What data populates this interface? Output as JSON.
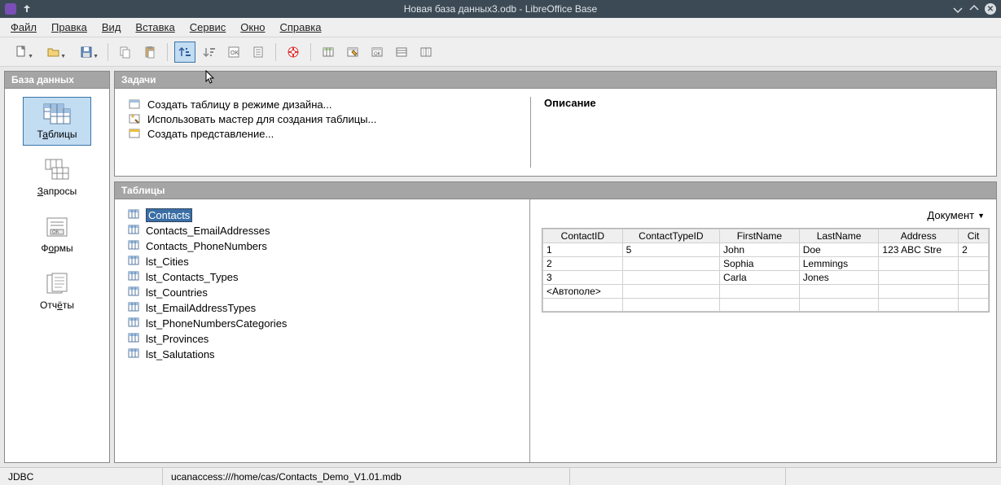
{
  "window": {
    "title": "Новая база данных3.odb - LibreOffice Base"
  },
  "menu": {
    "file": "Файл",
    "edit": "Правка",
    "view": "Вид",
    "insert": "Вставка",
    "service": "Сервис",
    "window": "Окно",
    "help": "Справка"
  },
  "sidebar": {
    "header": "База данных",
    "items": [
      {
        "label_pre": "Т",
        "label_ul": "а",
        "label_post": "блицы"
      },
      {
        "label_pre": "",
        "label_ul": "З",
        "label_post": "апросы"
      },
      {
        "label_pre": "Ф",
        "label_ul": "о",
        "label_post": "рмы"
      },
      {
        "label_pre": "Отч",
        "label_ul": "ё",
        "label_post": "ты"
      }
    ]
  },
  "tasks": {
    "header": "Задачи",
    "items": [
      "Создать таблицу в режиме дизайна...",
      "Использовать мастер для создания таблицы...",
      "Создать представление..."
    ],
    "desc_label": "Описание"
  },
  "tables_panel": {
    "header": "Таблицы",
    "list": [
      "Contacts",
      "Contacts_EmailAddresses",
      "Contacts_PhoneNumbers",
      "lst_Cities",
      "lst_Contacts_Types",
      "lst_Countries",
      "lst_EmailAddressTypes",
      "lst_PhoneNumbersCategories",
      "lst_Provinces",
      "lst_Salutations"
    ],
    "doc_button": "Документ",
    "columns": [
      "ContactID",
      "ContactTypeID",
      "FirstName",
      "LastName",
      "Address",
      "Cit"
    ],
    "rows": [
      {
        "c0": "1",
        "c1": "5",
        "c2": "John",
        "c3": "Doe",
        "c4": "123 ABC Stre",
        "c5": "2"
      },
      {
        "c0": "2",
        "c1": "",
        "c2": "Sophia",
        "c3": "Lemmings",
        "c4": "",
        "c5": ""
      },
      {
        "c0": "3",
        "c1": "",
        "c2": "Carla",
        "c3": "Jones",
        "c4": "",
        "c5": ""
      }
    ],
    "autofield": "<Автополе>"
  },
  "status": {
    "driver": "JDBC",
    "path": "ucanaccess:///home/cas/Contacts_Demo_V1.01.mdb"
  }
}
